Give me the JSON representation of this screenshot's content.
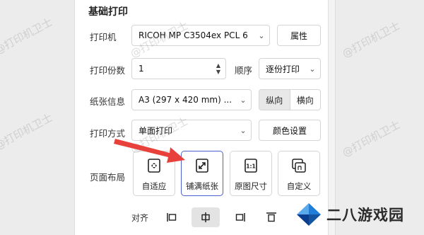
{
  "section": {
    "title": "基础打印"
  },
  "printer": {
    "label": "打印机",
    "value": "RICOH MP C3504ex PCL 6",
    "properties_button": "属性"
  },
  "copies": {
    "label": "打印份数",
    "value": "1",
    "order_label": "顺序",
    "order_value": "逐份打印"
  },
  "paper": {
    "label": "纸张信息",
    "value": "A3 (297 x 420 mm) ...",
    "orientation": {
      "portrait": "纵向",
      "landscape": "横向",
      "selected": "纵向"
    }
  },
  "mode": {
    "label": "打印方式",
    "value": "单面打印",
    "color_button": "颜色设置"
  },
  "layout": {
    "label": "页面布局",
    "options": [
      {
        "label": "自适应",
        "icon": "fit-adaptive-icon"
      },
      {
        "label": "铺满纸张",
        "icon": "fill-paper-icon"
      },
      {
        "label": "原图尺寸",
        "icon": "original-size-icon"
      },
      {
        "label": "自定义",
        "icon": "custom-size-icon"
      }
    ],
    "selected": "铺满纸张"
  },
  "align": {
    "label": "对齐",
    "options": [
      "align-left-icon",
      "align-center-icon",
      "align-right-icon",
      "align-top-icon"
    ],
    "selected": "align-center-icon"
  },
  "watermark": {
    "text": "@打印机卫士"
  },
  "brand": {
    "logo_text": "二八游戏园",
    "logo_colors": [
      "#1f7fd8",
      "#0a3d8f"
    ]
  },
  "colors": {
    "accent": "#4a5fd0",
    "arrow": "#e8403a"
  }
}
